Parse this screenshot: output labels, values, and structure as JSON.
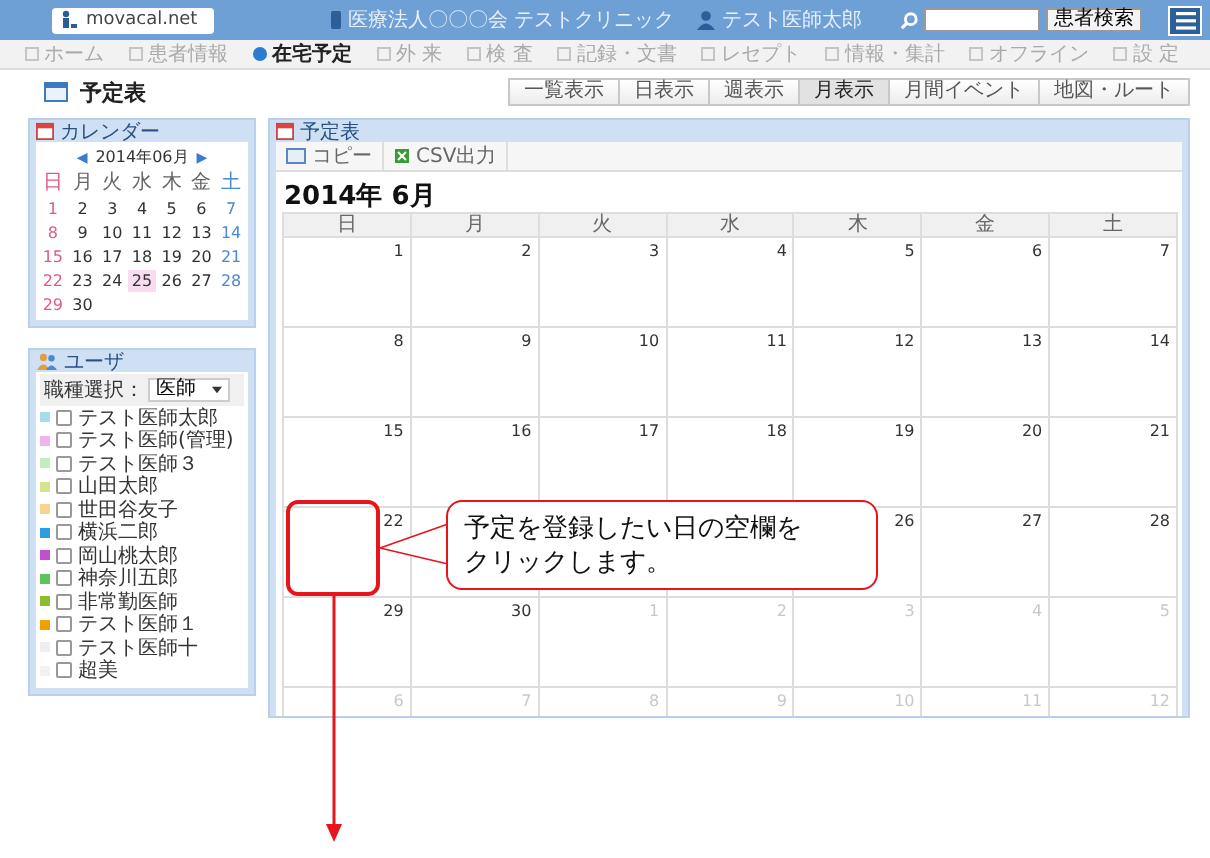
{
  "header": {
    "logo": "movacal.net",
    "clinic": "医療法人〇〇〇会 テストクリニック",
    "user": "テスト医師太郎",
    "search_button": "患者検索"
  },
  "nav": [
    {
      "label": "ホーム",
      "selected": false
    },
    {
      "label": "患者情報",
      "selected": false
    },
    {
      "label": "在宅予定",
      "selected": true
    },
    {
      "label": "外 来",
      "selected": false
    },
    {
      "label": "検 査",
      "selected": false
    },
    {
      "label": "記録・文書",
      "selected": false
    },
    {
      "label": "レセプト",
      "selected": false
    },
    {
      "label": "情報・集計",
      "selected": false
    },
    {
      "label": "オフライン",
      "selected": false
    },
    {
      "label": "設 定",
      "selected": false
    }
  ],
  "page_title": "予定表",
  "views": [
    {
      "label": "一覧表示",
      "selected": false
    },
    {
      "label": "日表示",
      "selected": false
    },
    {
      "label": "週表示",
      "selected": false
    },
    {
      "label": "月表示",
      "selected": true
    },
    {
      "label": "月間イベント",
      "selected": false
    },
    {
      "label": "地図・ルート",
      "selected": false
    }
  ],
  "mini_calendar": {
    "title": "カレンダー",
    "prev": "◀",
    "month": "2014年06月",
    "next": "▶",
    "weekdays": [
      "日",
      "月",
      "火",
      "水",
      "木",
      "金",
      "土"
    ],
    "weeks": [
      [
        {
          "day": "1",
          "selected": false
        },
        {
          "day": "2",
          "selected": false
        },
        {
          "day": "3",
          "selected": false
        },
        {
          "day": "4",
          "selected": false
        },
        {
          "day": "5",
          "selected": false
        },
        {
          "day": "6",
          "selected": false
        },
        {
          "day": "7",
          "selected": false
        }
      ],
      [
        {
          "day": "8",
          "selected": false
        },
        {
          "day": "9",
          "selected": false
        },
        {
          "day": "10",
          "selected": false
        },
        {
          "day": "11",
          "selected": false
        },
        {
          "day": "12",
          "selected": false
        },
        {
          "day": "13",
          "selected": false
        },
        {
          "day": "14",
          "selected": false
        }
      ],
      [
        {
          "day": "15",
          "selected": false
        },
        {
          "day": "16",
          "selected": false
        },
        {
          "day": "17",
          "selected": false
        },
        {
          "day": "18",
          "selected": false
        },
        {
          "day": "19",
          "selected": false
        },
        {
          "day": "20",
          "selected": false
        },
        {
          "day": "21",
          "selected": false
        }
      ],
      [
        {
          "day": "22",
          "selected": false
        },
        {
          "day": "23",
          "selected": false
        },
        {
          "day": "24",
          "selected": false
        },
        {
          "day": "25",
          "selected": true
        },
        {
          "day": "26",
          "selected": false
        },
        {
          "day": "27",
          "selected": false
        },
        {
          "day": "28",
          "selected": false
        }
      ],
      [
        {
          "day": "29",
          "selected": false
        },
        {
          "day": "30",
          "selected": false
        }
      ]
    ]
  },
  "users": {
    "title": "ユーザ",
    "filter_label": "職種選択：",
    "filter_value": "医師",
    "items": [
      {
        "name": "テスト医師太郎",
        "color": "#a8dce6",
        "checked": false
      },
      {
        "name": "テスト医師(管理)",
        "color": "#f0b4ec",
        "checked": false
      },
      {
        "name": "テスト医師３",
        "color": "#c4ecbc",
        "checked": false
      },
      {
        "name": "山田太郎",
        "color": "#d4e48c",
        "checked": false
      },
      {
        "name": "世田谷友子",
        "color": "#f8d48c",
        "checked": false
      },
      {
        "name": "横浜二郎",
        "color": "#2c9ee0",
        "checked": false
      },
      {
        "name": "岡山桃太郎",
        "color": "#c050d0",
        "checked": false
      },
      {
        "name": "神奈川五郎",
        "color": "#5cc45c",
        "checked": false
      },
      {
        "name": "非常勤医師",
        "color": "#8cbc30",
        "checked": false
      },
      {
        "name": "テスト医師１",
        "color": "#f0a000",
        "checked": false
      },
      {
        "name": "テスト医師十",
        "color": "#eeeeee",
        "checked": false
      },
      {
        "name": "超美",
        "color": "#f2f2f2",
        "checked": false
      }
    ]
  },
  "schedule": {
    "title": "予定表",
    "toolbar": [
      "コピー",
      "CSV出力"
    ],
    "month": "2014年 6月",
    "weekdays": [
      "日",
      "月",
      "火",
      "水",
      "木",
      "金",
      "土"
    ],
    "weeks": [
      [
        {
          "kind": "day",
          "day": "1",
          "other_month": false
        },
        {
          "kind": "day",
          "day": "2",
          "other_month": false
        },
        {
          "kind": "day",
          "day": "3",
          "other_month": false
        },
        {
          "kind": "day",
          "day": "4",
          "other_month": false
        },
        {
          "kind": "day",
          "day": "5",
          "other_month": false
        },
        {
          "kind": "day",
          "day": "6",
          "other_month": false
        },
        {
          "kind": "day",
          "day": "7",
          "other_month": false
        }
      ],
      [
        {
          "kind": "day",
          "day": "8",
          "other_month": false
        },
        {
          "kind": "day",
          "day": "9",
          "other_month": false
        },
        {
          "kind": "day",
          "day": "10",
          "other_month": false
        },
        {
          "kind": "day",
          "day": "11",
          "other_month": false
        },
        {
          "kind": "day",
          "day": "12",
          "other_month": false
        },
        {
          "kind": "day",
          "day": "13",
          "other_month": false
        },
        {
          "kind": "day",
          "day": "14",
          "other_month": false
        }
      ],
      [
        {
          "kind": "day",
          "day": "15",
          "other_month": false
        },
        {
          "kind": "day",
          "day": "16",
          "other_month": false
        },
        {
          "kind": "day",
          "day": "17",
          "other_month": false
        },
        {
          "kind": "day",
          "day": "18",
          "other_month": false
        },
        {
          "kind": "day",
          "day": "19",
          "other_month": false
        },
        {
          "kind": "day",
          "day": "20",
          "other_month": false
        },
        {
          "kind": "day",
          "day": "21",
          "other_month": false
        }
      ],
      [
        {
          "kind": "day",
          "day": "22",
          "other_month": false
        },
        {
          "kind": "blank"
        },
        {
          "kind": "blank"
        },
        {
          "kind": "blank"
        },
        {
          "kind": "day",
          "day": "26",
          "other_month": false
        },
        {
          "kind": "day",
          "day": "27",
          "other_month": false
        },
        {
          "kind": "day",
          "day": "28",
          "other_month": false
        }
      ],
      [
        {
          "kind": "day",
          "day": "29",
          "other_month": false
        },
        {
          "kind": "day",
          "day": "30",
          "other_month": false
        },
        {
          "kind": "day",
          "day": "1",
          "other_month": true
        },
        {
          "kind": "day",
          "day": "2",
          "other_month": true
        },
        {
          "kind": "day",
          "day": "3",
          "other_month": true
        },
        {
          "kind": "day",
          "day": "4",
          "other_month": true
        },
        {
          "kind": "day",
          "day": "5",
          "other_month": true
        }
      ],
      [
        {
          "kind": "day",
          "day": "6",
          "other_month": true
        },
        {
          "kind": "day",
          "day": "7",
          "other_month": true
        },
        {
          "kind": "day",
          "day": "8",
          "other_month": true
        },
        {
          "kind": "day",
          "day": "9",
          "other_month": true
        },
        {
          "kind": "day",
          "day": "10",
          "other_month": true
        },
        {
          "kind": "day",
          "day": "11",
          "other_month": true
        },
        {
          "kind": "day",
          "day": "12",
          "other_month": true
        }
      ]
    ]
  },
  "callout": {
    "lines": [
      "予定を登録したい日の空欄を",
      "クリックします。"
    ]
  }
}
